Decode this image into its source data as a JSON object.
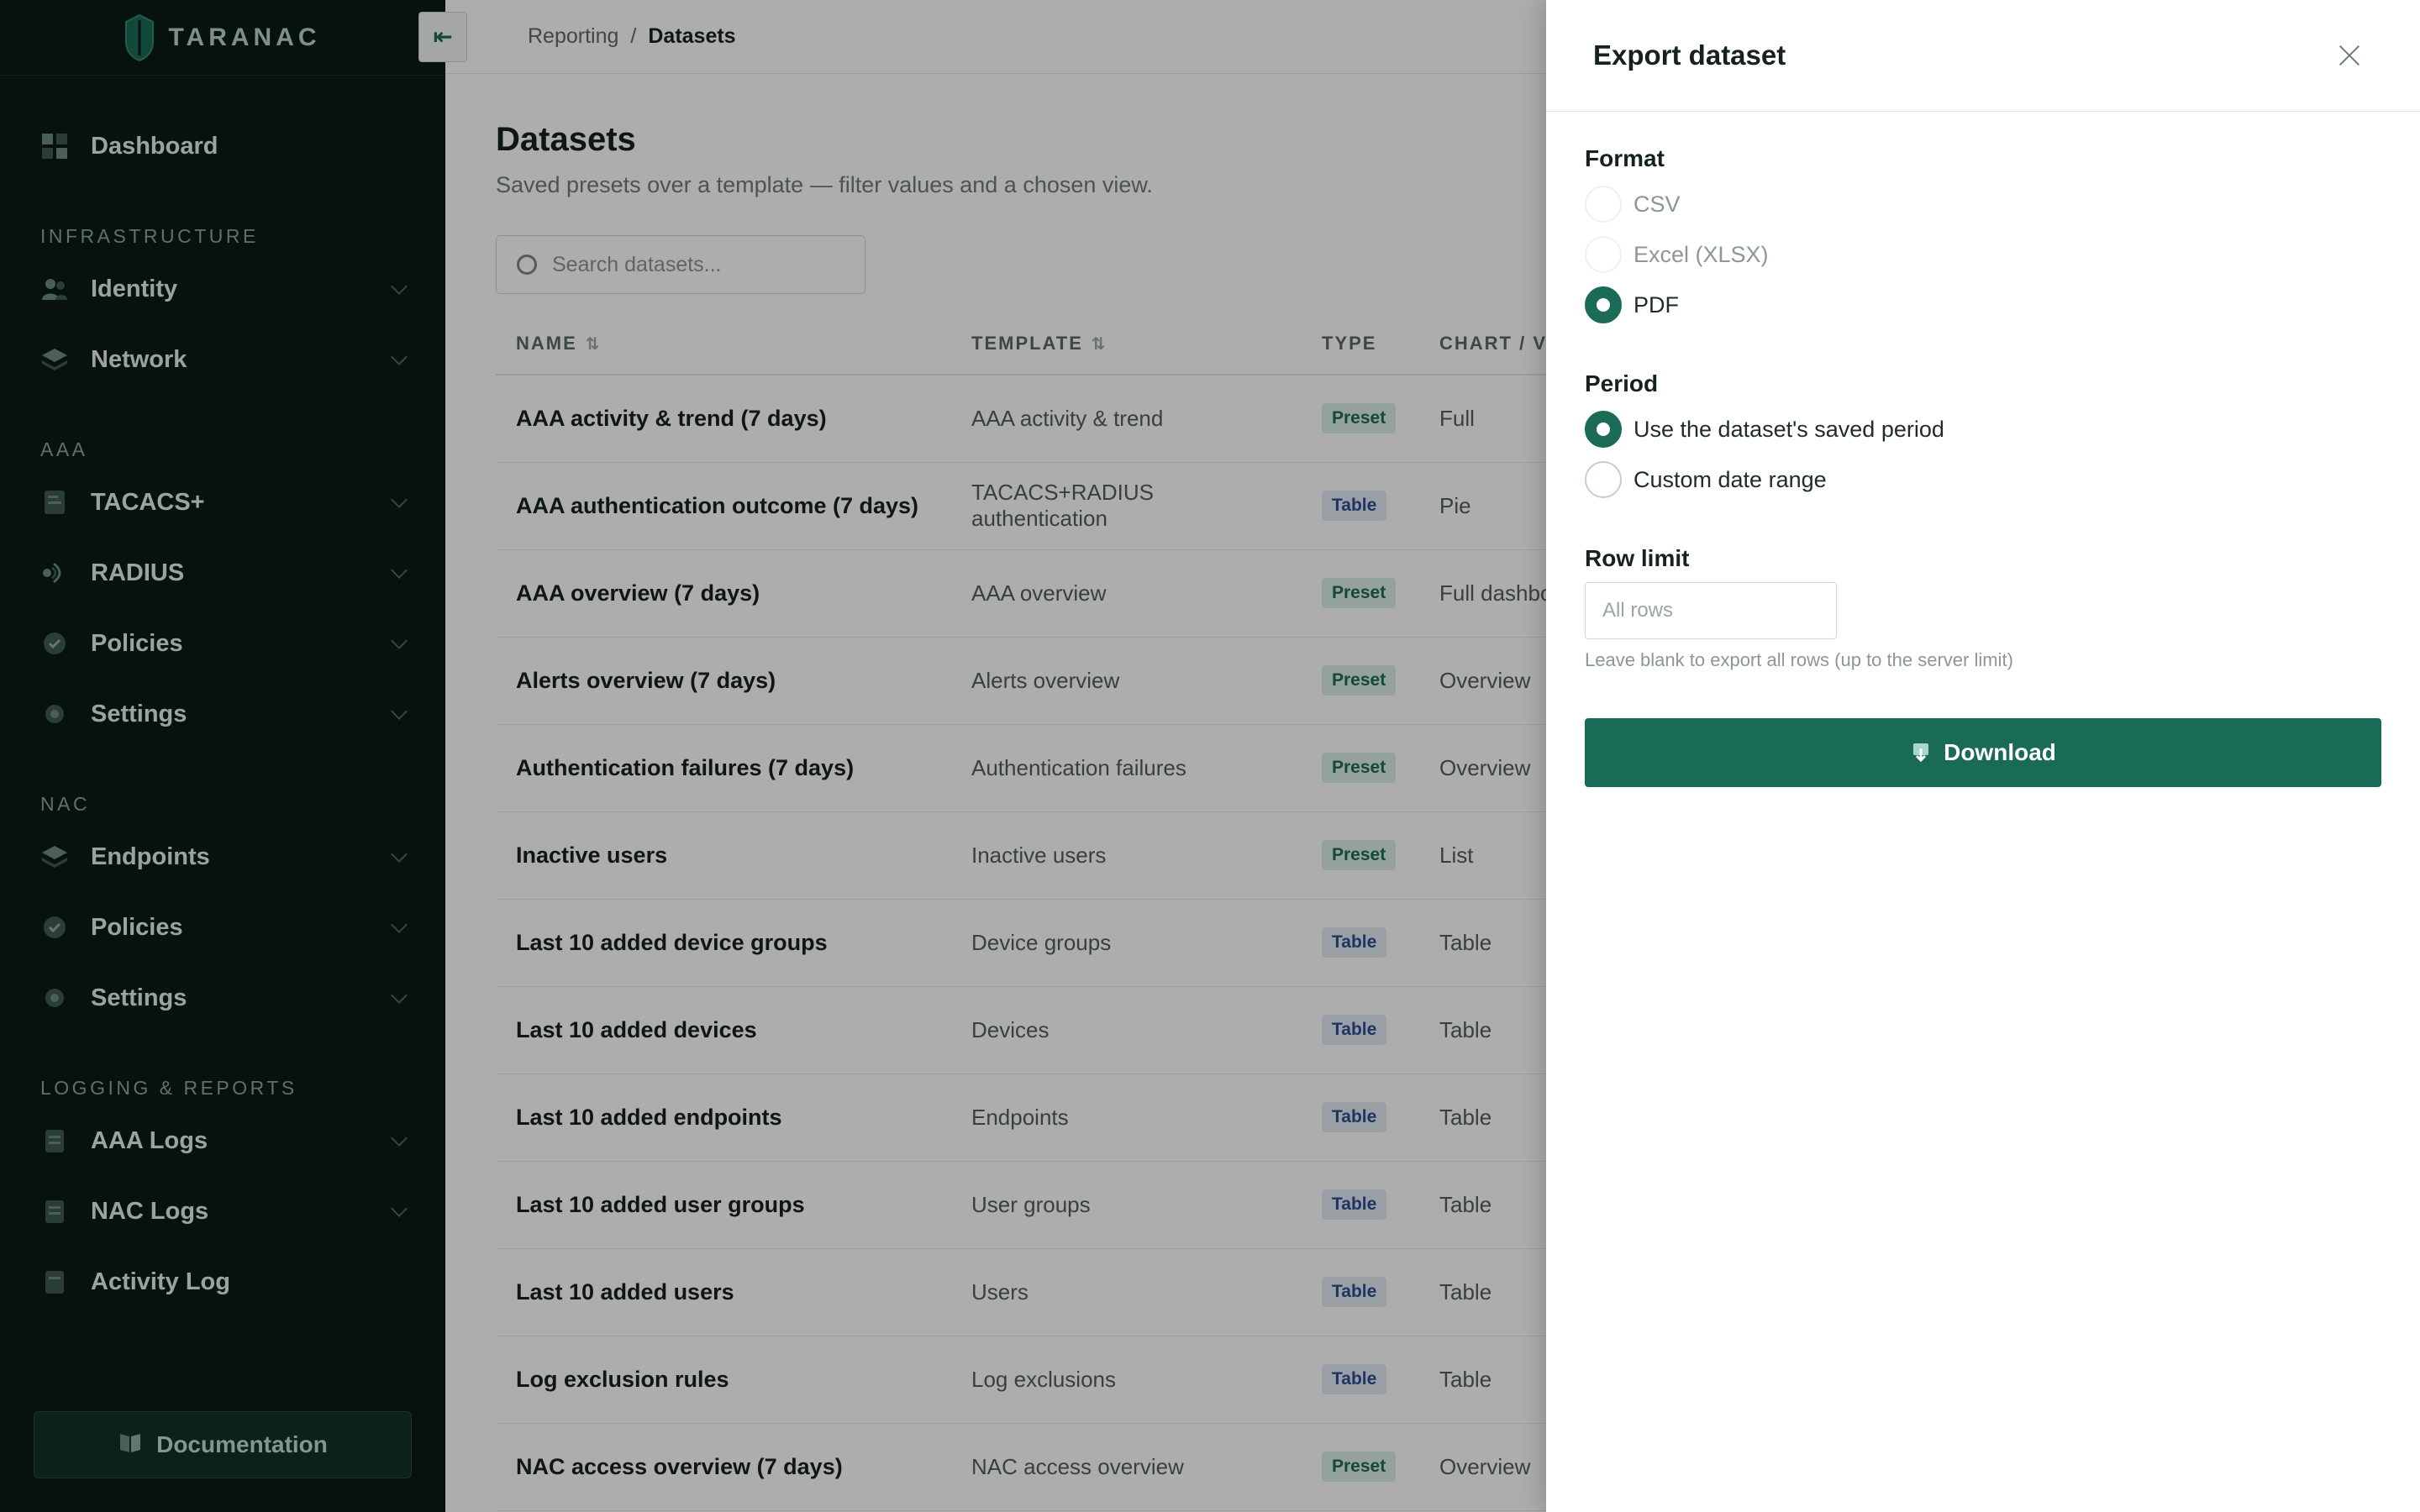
{
  "brand": {
    "name": "TARANAC"
  },
  "sidebar": {
    "top_item": {
      "label": "Dashboard",
      "icon": "dashboard-icon"
    },
    "sections": [
      {
        "label": "INFRASTRUCTURE",
        "items": [
          {
            "label": "Identity",
            "icon": "users-icon"
          },
          {
            "label": "Network",
            "icon": "layers-icon"
          }
        ]
      },
      {
        "label": "AAA",
        "items": [
          {
            "label": "TACACS+",
            "icon": "document-icon"
          },
          {
            "label": "RADIUS",
            "icon": "radius-icon"
          },
          {
            "label": "Policies",
            "icon": "shield-check-icon"
          },
          {
            "label": "Settings",
            "icon": "gear-icon"
          }
        ]
      },
      {
        "label": "NAC",
        "items": [
          {
            "label": "Endpoints",
            "icon": "layers-icon"
          },
          {
            "label": "Policies",
            "icon": "shield-check-icon"
          },
          {
            "label": "Settings",
            "icon": "gear-icon"
          }
        ]
      },
      {
        "label": "LOGGING & REPORTS",
        "items": [
          {
            "label": "AAA Logs",
            "icon": "log-icon"
          },
          {
            "label": "NAC Logs",
            "icon": "log-icon"
          },
          {
            "label": "Activity Log",
            "icon": "log-icon"
          }
        ]
      }
    ],
    "footer": {
      "label": "Documentation",
      "icon": "book-icon"
    }
  },
  "topbar": {
    "collapse_icon": "arrow-left-icon",
    "breadcrumb": [
      "Reporting",
      "Datasets"
    ],
    "separator": "/"
  },
  "page": {
    "title": "Datasets",
    "subtitle": "Saved presets over a template — filter values and a chosen view.",
    "search_placeholder": "Search datasets..."
  },
  "table": {
    "columns": [
      "NAME",
      "TEMPLATE",
      "TYPE",
      "CHART / VI"
    ],
    "rows": [
      {
        "name": "AAA activity & trend (7 days)",
        "template": "AAA activity & trend",
        "type": "Preset",
        "chart": "Full"
      },
      {
        "name": "AAA authentication outcome (7 days)",
        "template": "TACACS+RADIUS authentication",
        "type": "Table",
        "chart": "Pie"
      },
      {
        "name": "AAA overview (7 days)",
        "template": "AAA overview",
        "type": "Preset",
        "chart": "Full dashboard"
      },
      {
        "name": "Alerts overview (7 days)",
        "template": "Alerts overview",
        "type": "Preset",
        "chart": "Overview"
      },
      {
        "name": "Authentication failures (7 days)",
        "template": "Authentication failures",
        "type": "Preset",
        "chart": "Overview"
      },
      {
        "name": "Inactive users",
        "template": "Inactive users",
        "type": "Preset",
        "chart": "List"
      },
      {
        "name": "Last 10 added device groups",
        "template": "Device groups",
        "type": "Table",
        "chart": "Table"
      },
      {
        "name": "Last 10 added devices",
        "template": "Devices",
        "type": "Table",
        "chart": "Table"
      },
      {
        "name": "Last 10 added endpoints",
        "template": "Endpoints",
        "type": "Table",
        "chart": "Table"
      },
      {
        "name": "Last 10 added user groups",
        "template": "User groups",
        "type": "Table",
        "chart": "Table"
      },
      {
        "name": "Last 10 added users",
        "template": "Users",
        "type": "Table",
        "chart": "Table"
      },
      {
        "name": "Log exclusion rules",
        "template": "Log exclusions",
        "type": "Table",
        "chart": "Table"
      },
      {
        "name": "NAC access overview (7 days)",
        "template": "NAC access overview",
        "type": "Preset",
        "chart": "Overview"
      }
    ]
  },
  "export_drawer": {
    "title": "Export dataset",
    "format": {
      "label": "Format",
      "options": [
        "CSV",
        "Excel (XLSX)",
        "PDF"
      ],
      "selected": "PDF"
    },
    "period": {
      "label": "Period",
      "options": [
        "Use the dataset's saved period",
        "Custom date range"
      ],
      "selected": "Use the dataset's saved period"
    },
    "row_limit": {
      "label": "Row limit",
      "placeholder": "All rows",
      "hint": "Leave blank to export all rows (up to the server limit)"
    },
    "download_label": "Download"
  },
  "colors": {
    "sidebar_bg": "#0b1b17",
    "accent": "#1a6b55",
    "preset_badge": "#dcefe6",
    "table_badge": "#e3eaf5"
  }
}
